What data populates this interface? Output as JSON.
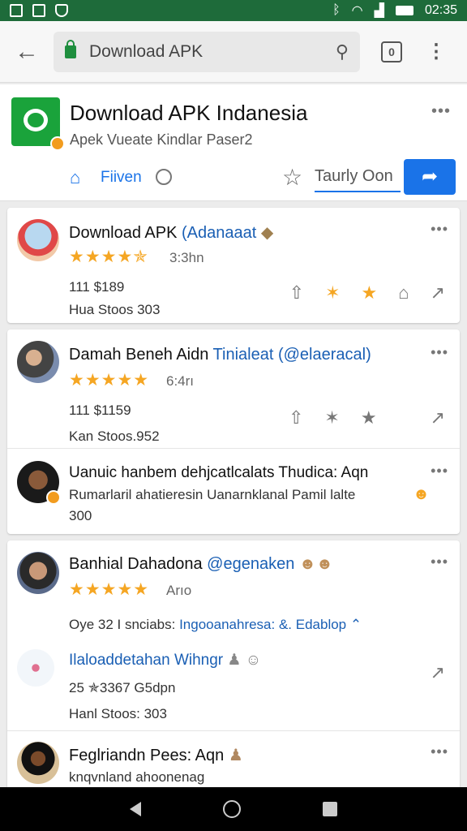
{
  "status_bar": {
    "time": "02:35",
    "icons": [
      "image-icon",
      "photo-icon",
      "shield-icon",
      "bluetooth-icon",
      "wifi-icon",
      "signal-icon",
      "battery-icon"
    ]
  },
  "browser": {
    "url": "Download APK",
    "tabs_count": "0"
  },
  "site": {
    "title": "Download APK Indanesia",
    "subtitle": "Apek Vueate Kindlar Paser2",
    "home_label": "Fiiven",
    "follow_label": "Taurly Oon"
  },
  "posts": [
    {
      "name": "Download APK",
      "handle": "(Adanaaat",
      "rating": "★★★★✯",
      "rating_meta": "3:3hn",
      "line1": "111 $189",
      "line2": "Hua Stoos 303"
    },
    {
      "name": "Damah Beneh Aidn",
      "handle": "Tinialeat (@elaeracal)",
      "rating": "★★★★★",
      "rating_meta": "6:4rı",
      "line1": "111 $1159",
      "line2": "Kan Stoos.952"
    },
    {
      "name": "Uanuic hanbem dehjcatlcalats Thudica: Aqn",
      "line1": "Rumarlaril ahatieresin Uanarnklanal Pamil lalte",
      "line2": "300"
    },
    {
      "name": "Banhial Dahadona",
      "handle": "@egenaken",
      "rating": "★★★★★",
      "rating_meta": "Arıo",
      "line1": "Oye 32 I snciabs:",
      "line1_link": "Ingooanahresa: &. Edablop",
      "sub_name": "Ilaloaddetahan Wihngr",
      "line2": "25 ✯3367 G5dpn",
      "line3": "Hanl Stoos: 303"
    },
    {
      "name": "Feglriandn Pees: Aqn",
      "line1": "knqvnland ahoonenag"
    }
  ],
  "colors": {
    "status_bar": "#1e6b3a",
    "accent": "#1a73e8",
    "star": "#f5a623",
    "brand": "#1aa33b"
  }
}
